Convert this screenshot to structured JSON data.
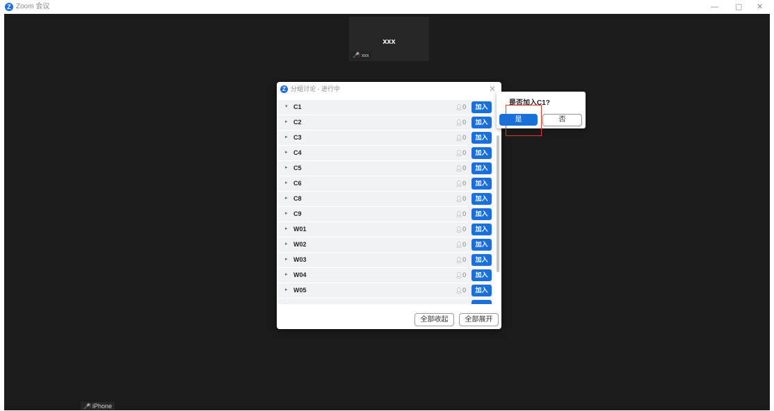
{
  "window": {
    "title": "Zoom 会议",
    "logo_glyph": "Z",
    "controls": [
      "—",
      "▢",
      "✕"
    ]
  },
  "meeting": {
    "tile": {
      "name": "xxx",
      "label": "xxx"
    },
    "self_label": "iPhone"
  },
  "breakout": {
    "logo_glyph": "Z",
    "title": "分组讨论 - 进行中",
    "close_glyph": "✕",
    "rooms": [
      {
        "caret": "▾",
        "name": "C1",
        "count": "0",
        "join": "加入"
      },
      {
        "caret": "▸",
        "name": "C2",
        "count": "0",
        "join": "加入"
      },
      {
        "caret": "▸",
        "name": "C3",
        "count": "0",
        "join": "加入"
      },
      {
        "caret": "▸",
        "name": "C4",
        "count": "0",
        "join": "加入"
      },
      {
        "caret": "▸",
        "name": "C5",
        "count": "0",
        "join": "加入"
      },
      {
        "caret": "▸",
        "name": "C6",
        "count": "0",
        "join": "加入"
      },
      {
        "caret": "▸",
        "name": "C8",
        "count": "0",
        "join": "加入"
      },
      {
        "caret": "▸",
        "name": "C9",
        "count": "0",
        "join": "加入"
      },
      {
        "caret": "▸",
        "name": "W01",
        "count": "0",
        "join": "加入"
      },
      {
        "caret": "▸",
        "name": "W02",
        "count": "0",
        "join": "加入"
      },
      {
        "caret": "▸",
        "name": "W03",
        "count": "0",
        "join": "加入"
      },
      {
        "caret": "▸",
        "name": "W04",
        "count": "0",
        "join": "加入"
      },
      {
        "caret": "▸",
        "name": "W05",
        "count": "0",
        "join": "加入"
      },
      {
        "caret": "▸",
        "name": "",
        "count": "",
        "join": ""
      }
    ],
    "collapse_all": "全部收起",
    "expand_all": "全部展开"
  },
  "confirm": {
    "question": "是否加入C1?",
    "yes": "是",
    "no": "否"
  },
  "colors": {
    "accent": "#1a6fd8",
    "highlight": "#e0352b",
    "stage_bg": "#1b1b1b"
  }
}
